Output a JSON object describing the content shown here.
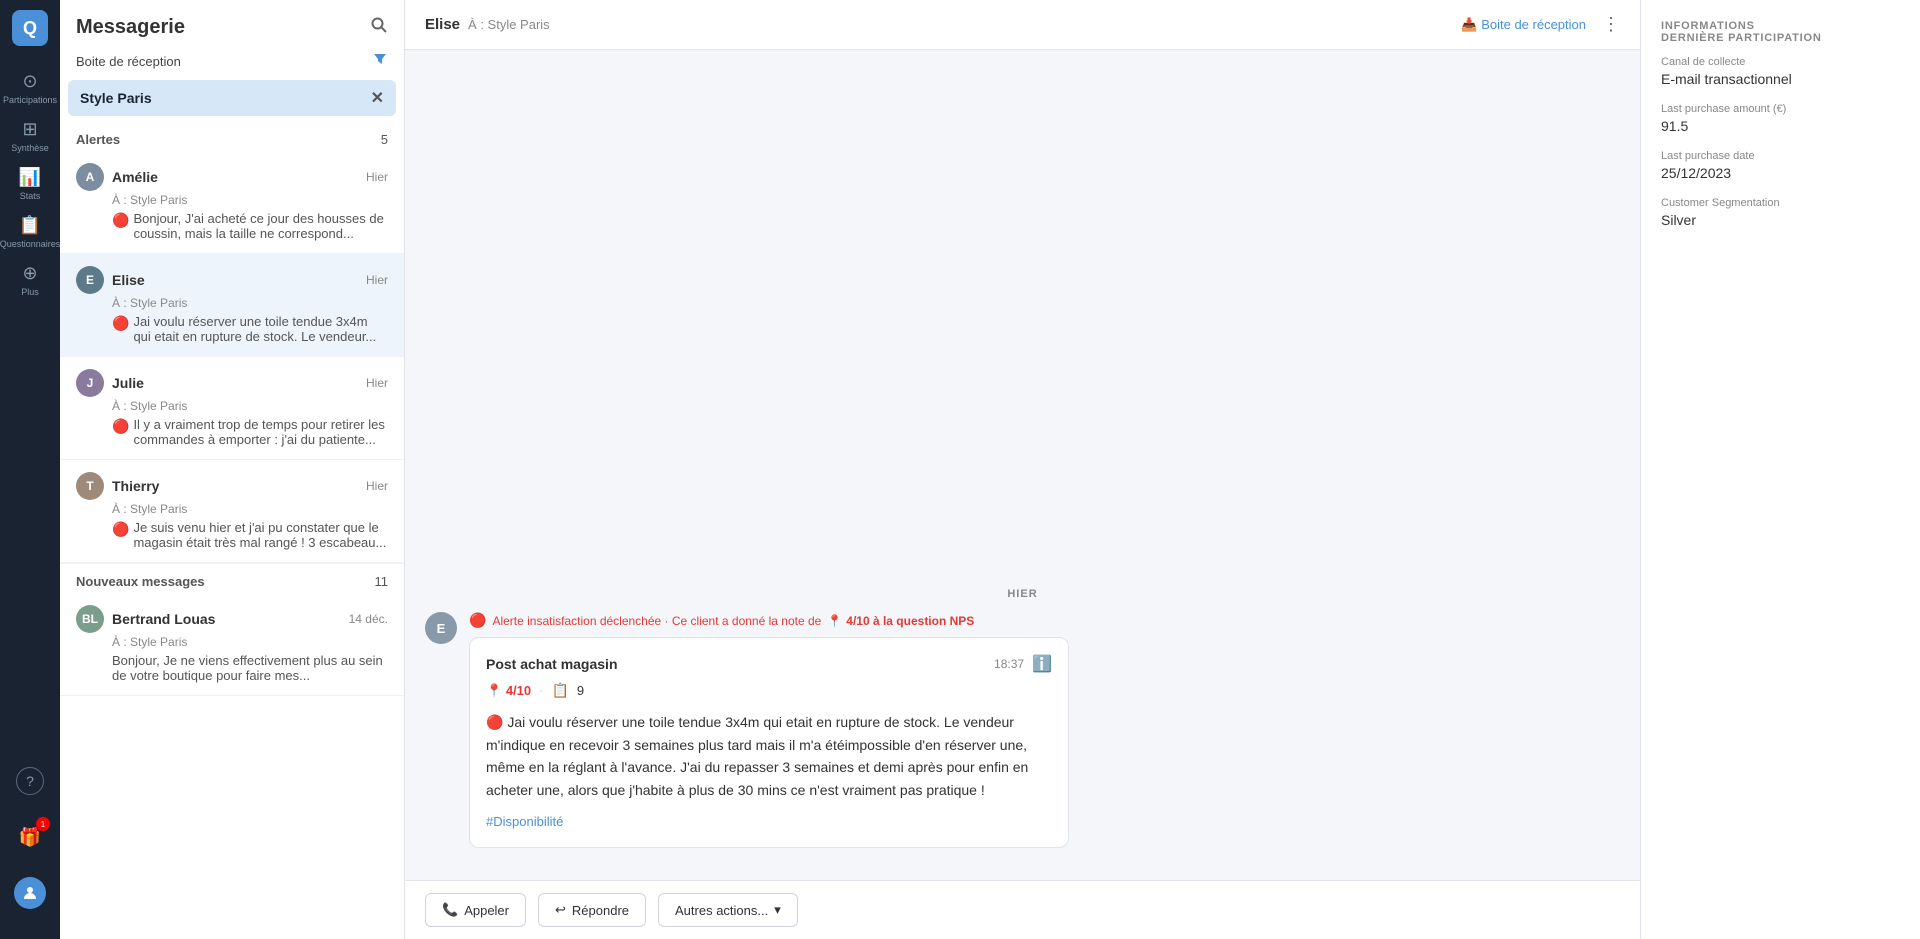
{
  "app": {
    "logo": "Q",
    "nav": {
      "items": [
        {
          "id": "participations",
          "label": "Participations",
          "icon": "⊙"
        },
        {
          "id": "synthese",
          "label": "Synthèse",
          "icon": "⊞"
        },
        {
          "id": "stats",
          "label": "Stats",
          "icon": "📊"
        },
        {
          "id": "questionnaires",
          "label": "Questionnaires",
          "icon": "📋"
        },
        {
          "id": "plus",
          "label": "Plus",
          "icon": "⊕"
        }
      ],
      "bottom": [
        {
          "id": "help",
          "icon": "?"
        },
        {
          "id": "gifts",
          "icon": "🎁",
          "badge": "1"
        },
        {
          "id": "user",
          "icon": "👤"
        }
      ]
    }
  },
  "sidebar": {
    "title": "Messagerie",
    "filter_label": "Boite de réception",
    "active_filter": "Style Paris",
    "sections": {
      "alerts": {
        "title": "Alertes",
        "count": "5"
      },
      "new_messages": {
        "title": "Nouveaux messages",
        "count": "11"
      }
    },
    "conversations": [
      {
        "id": "amelie",
        "initials": "A",
        "name": "Amélie",
        "to": "À : Style Paris",
        "date": "Hier",
        "preview": "Bonjour, J'ai acheté ce jour des housses de coussin, mais la taille ne correspond...",
        "has_alert": true,
        "active": false,
        "bg": "#7B8D9E"
      },
      {
        "id": "elise",
        "initials": "E",
        "name": "Elise",
        "to": "À : Style Paris",
        "date": "Hier",
        "preview": "Jai voulu réserver une toile tendue 3x4m qui etait en rupture de stock. Le vendeur...",
        "has_alert": true,
        "active": true,
        "bg": "#7B8D9E"
      },
      {
        "id": "julie",
        "initials": "J",
        "name": "Julie",
        "to": "À : Style Paris",
        "date": "Hier",
        "preview": "Il y a vraiment trop de temps pour retirer les commandes à emporter : j'ai du patiente...",
        "has_alert": true,
        "active": false,
        "bg": "#7B8D9E"
      },
      {
        "id": "thierry",
        "initials": "T",
        "name": "Thierry",
        "to": "À : Style Paris",
        "date": "Hier",
        "preview": "Je suis venu hier et j'ai pu constater que le magasin était très mal rangé ! 3 escabeau...",
        "has_alert": true,
        "active": false,
        "bg": "#7B8D9E"
      },
      {
        "id": "bertrand",
        "initials": "BL",
        "name": "Bertrand Louas",
        "to": "À : Style Paris",
        "date": "14 déc.",
        "preview": "Bonjour, Je ne viens effectivement plus au sein de votre boutique pour faire mes...",
        "has_alert": false,
        "active": false,
        "bg": "#7B8D9E"
      }
    ]
  },
  "chat": {
    "sender": "Elise",
    "to": "À : Style Paris",
    "inbox_label": "Boite de réception",
    "more_icon": "⋮",
    "date_divider": "HIER",
    "alert_text": "Alerte insatisfaction déclenchée · Ce client a donné la note de",
    "alert_score": "4/10 à la question NPS",
    "message_card": {
      "title": "Post achat magasin",
      "time": "18:37",
      "score_label": "4/10",
      "score_dot": "·",
      "views": "9",
      "body": "Jai voulu réserver une toile tendue 3x4m qui etait en rupture de stock. Le vendeur m'indique en recevoir 3 semaines plus tard mais il m'a étéimpossible d'en réserver une, même en la réglant à l'avance. J'ai du repasser 3 semaines et demi après pour enfin en acheter une, alors que j'habite à plus de 30 mins ce n'est vraiment pas pratique !",
      "tag": "#Disponibilité"
    },
    "actions": {
      "call": "Appeler",
      "reply": "Répondre",
      "other": "Autres actions...",
      "dropdown_arrow": "▾"
    }
  },
  "right_panel": {
    "section_title": "INFORMATIONS\nDERNIÈRE PARTICIPATION",
    "section_line1": "INFORMATIONS",
    "section_line2": "DERNIÈRE PARTICIPATION",
    "fields": [
      {
        "label": "Canal de collecte",
        "value": "E-mail transactionnel"
      },
      {
        "label": "Last purchase amount (€)",
        "value": "91.5"
      },
      {
        "label": "Last purchase date",
        "value": "25/12/2023"
      },
      {
        "label": "Customer Segmentation",
        "value": "Silver"
      }
    ]
  }
}
